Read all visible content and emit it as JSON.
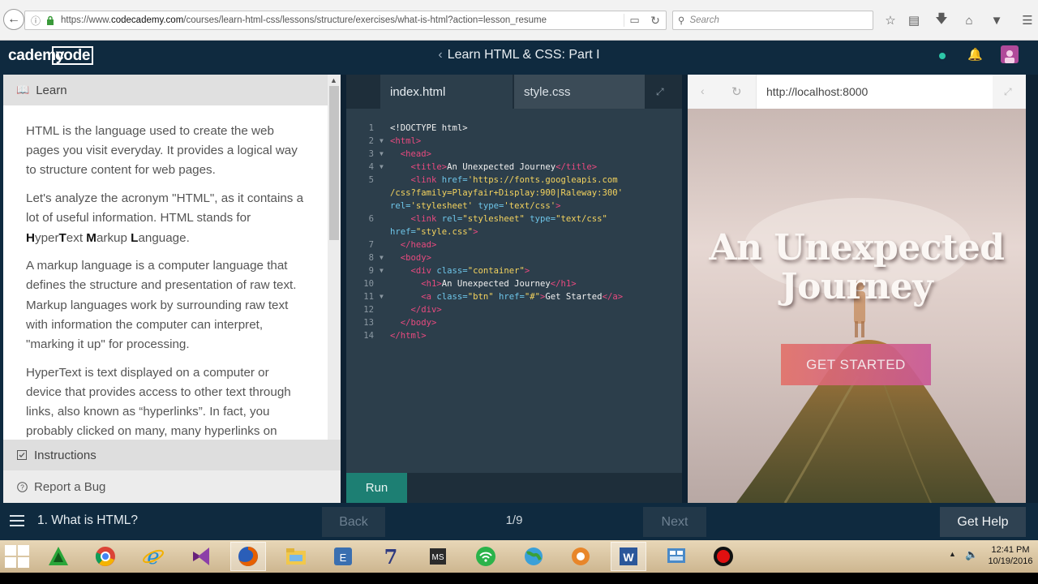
{
  "browser": {
    "url_prefix": "https://www.",
    "url_domain": "codecademy.com",
    "url_path": "/courses/learn-html-css/lessons/structure/exercises/what-is-html?action=lesson_resume",
    "search_placeholder": "Search"
  },
  "header": {
    "logo_left": "code",
    "logo_right": "cademy",
    "course_title": "Learn HTML & CSS: Part I",
    "status_color": "#2dc6a8"
  },
  "learn": {
    "heading": "Learn",
    "paragraphs": [
      "HTML is the language used to create the web pages you visit everyday. It provides a logical way to structure content for web pages.",
      "Let's analyze the acronym \"HTML\", as it contains a lot of useful information. HTML stands for",
      "A markup language is a computer language that defines the structure and presentation of raw text. Markup languages work by surrounding raw text with information the computer can interpret, \"marking it up\" for processing.",
      "HyperText is text displayed on a computer or device that provides access to other text through links, also known as “hyperlinks”. In fact, you probably clicked on many, many hyperlinks on"
    ],
    "acronym": {
      "h": "H",
      "yper": "yper",
      "t": "T",
      "ext": "ext ",
      "m": "M",
      "arkup": "arkup ",
      "l": "L",
      "anguage": "anguage."
    },
    "instructions_label": "Instructions",
    "bug_label": "Report a Bug"
  },
  "editor": {
    "tabs": [
      "index.html",
      "style.css"
    ],
    "run_label": "Run",
    "line_numbers": [
      "1",
      "2",
      "3",
      "4",
      "5",
      "6",
      "7",
      "8",
      "9",
      "10",
      "11",
      "12",
      "13",
      "14"
    ]
  },
  "preview": {
    "url": "http://localhost:8000",
    "heading": "An Unexpected Journey",
    "button": "GET STARTED"
  },
  "lesson_nav": {
    "lesson_name": "1. What is HTML?",
    "back_label": "Back",
    "progress": "1/9",
    "next_label": "Next",
    "help_label": "Get Help"
  },
  "taskbar": {
    "time": "12:41 PM",
    "date": "10/19/2016"
  }
}
